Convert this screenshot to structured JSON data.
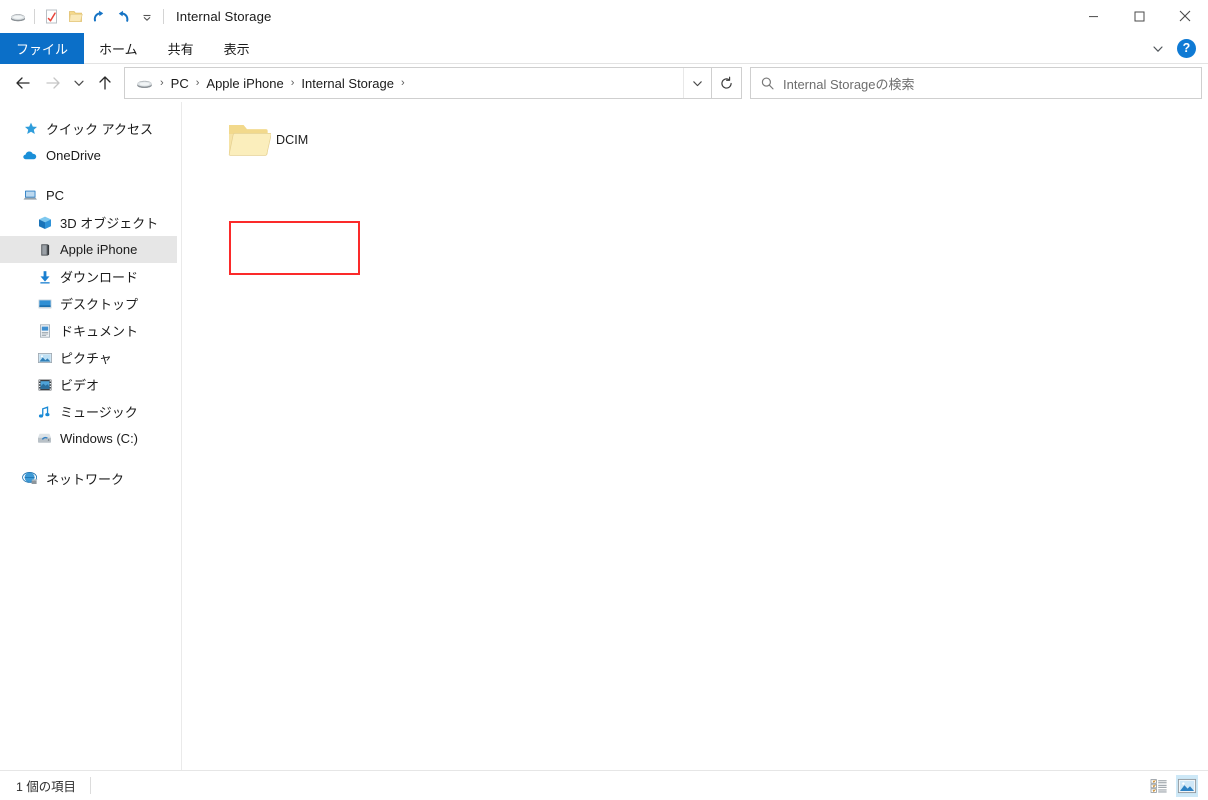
{
  "window": {
    "title": "Internal Storage"
  },
  "quick_access_toolbar": {
    "items": [
      {
        "name": "drive-icon",
        "label": ""
      },
      {
        "name": "properties-icon",
        "label": ""
      },
      {
        "name": "new-folder-icon",
        "label": ""
      },
      {
        "name": "redo-icon",
        "label": ""
      },
      {
        "name": "undo-icon",
        "label": ""
      },
      {
        "name": "customize-chevron-icon",
        "label": ""
      }
    ]
  },
  "window_controls": {
    "minimize": "—",
    "maximize": "□",
    "close": "✕"
  },
  "ribbon": {
    "tabs": [
      {
        "label": "ファイル",
        "selected": true
      },
      {
        "label": "ホーム",
        "selected": false
      },
      {
        "label": "共有",
        "selected": false
      },
      {
        "label": "表示",
        "selected": false
      }
    ],
    "expand_label": "",
    "help_label": "?"
  },
  "navigation": {
    "back_label": "",
    "forward_label": "",
    "recent_label": "",
    "up_label": "",
    "refresh_label": "",
    "breadcrumb": [
      {
        "label": "PC"
      },
      {
        "label": "Apple iPhone"
      },
      {
        "label": "Internal Storage"
      }
    ],
    "breadcrumb_separator": "›"
  },
  "search": {
    "placeholder": "Internal Storageの検索",
    "value": ""
  },
  "sidebar": {
    "items": [
      {
        "label": "クイック アクセス",
        "icon": "star-icon",
        "indent": false,
        "selected": false
      },
      {
        "label": "OneDrive",
        "icon": "cloud-icon",
        "indent": false,
        "selected": false
      },
      {
        "label": "PC",
        "icon": "pc-icon",
        "indent": false,
        "selected": false
      },
      {
        "label": "3D オブジェクト",
        "icon": "cube-icon",
        "indent": true,
        "selected": false
      },
      {
        "label": "Apple iPhone",
        "icon": "phone-device-icon",
        "indent": true,
        "selected": true
      },
      {
        "label": "ダウンロード",
        "icon": "download-icon",
        "indent": true,
        "selected": false
      },
      {
        "label": "デスクトップ",
        "icon": "desktop-icon",
        "indent": true,
        "selected": false
      },
      {
        "label": "ドキュメント",
        "icon": "documents-icon",
        "indent": true,
        "selected": false
      },
      {
        "label": "ピクチャ",
        "icon": "pictures-icon",
        "indent": true,
        "selected": false
      },
      {
        "label": "ビデオ",
        "icon": "videos-icon",
        "indent": true,
        "selected": false
      },
      {
        "label": "ミュージック",
        "icon": "music-icon",
        "indent": true,
        "selected": false
      },
      {
        "label": "Windows (C:)",
        "icon": "harddrive-icon",
        "indent": true,
        "selected": false
      },
      {
        "label": "ネットワーク",
        "icon": "network-icon",
        "indent": false,
        "selected": false
      }
    ]
  },
  "content": {
    "items": [
      {
        "label": "DCIM",
        "type": "folder",
        "highlighted": true
      }
    ]
  },
  "statusbar": {
    "item_count_text": "1 個の項目",
    "view_details_label": "",
    "view_large_icons_label": ""
  },
  "colors": {
    "accent_blue": "#0b6fc8",
    "help_blue": "#0f7ad4",
    "selection_grey": "#e6e6e6",
    "annotation_red": "#fb2a2a",
    "folder_yellow": "#f7dc92",
    "view_active_blue": "#cde8f7"
  }
}
